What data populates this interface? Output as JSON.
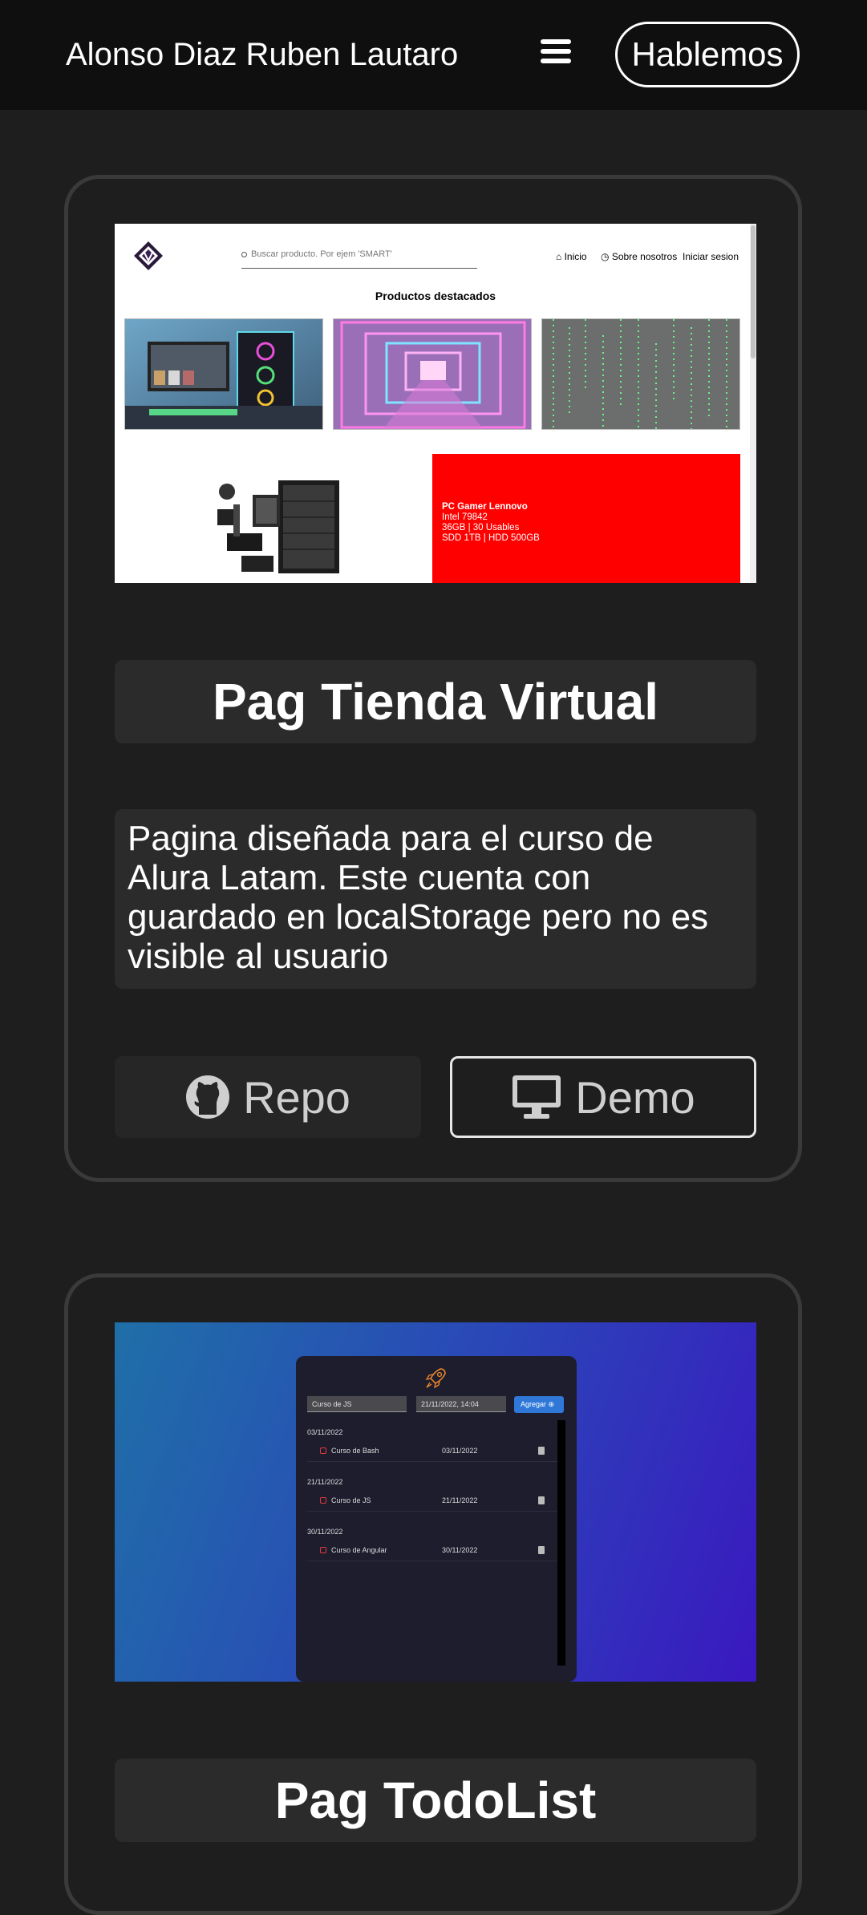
{
  "nav": {
    "brand": "Alonso Diaz Ruben Lautaro",
    "menu_icon": "hamburger-icon",
    "cta_label": "Hablemos"
  },
  "projects": [
    {
      "title": "Pag Tienda Virtual",
      "description": "Pagina diseñada para el curso de Alura Latam. Este cuenta con guardado en localStorage pero no es visible al usuario",
      "repo_label": "Repo",
      "demo_label": "Demo",
      "repo_icon": "github-icon",
      "demo_icon": "desktop-icon",
      "preview": {
        "search_placeholder": "Buscar producto. Por ejem 'SMART'",
        "menu": [
          "Inicio",
          "Sobre nosotros",
          "Iniciar sesion"
        ],
        "heading": "Productos destacados",
        "promo_title": "PC Gamer Lennovo",
        "promo_lines": [
          "Intel 79842",
          "36GB | 30 Usables",
          "SDD 1TB | HDD 500GB"
        ]
      }
    },
    {
      "title": "Pag TodoList",
      "preview": {
        "task_input": "Curso de JS",
        "date_input": "21/11/2022, 14:04",
        "add_label": "Agregar",
        "groups": [
          {
            "date": "03/11/2022",
            "task": "Curso de Bash",
            "task_date": "03/11/2022"
          },
          {
            "date": "21/11/2022",
            "task": "Curso de JS",
            "task_date": "21/11/2022"
          },
          {
            "date": "30/11/2022",
            "task": "Curso de Angular",
            "task_date": "30/11/2022"
          }
        ]
      }
    }
  ],
  "colors": {
    "background": "#1e1e1e",
    "nav_background": "#0f0f0f",
    "card_border": "#3a3a3a",
    "box_background": "#2b2b2b",
    "promo_red": "#ff0000"
  }
}
